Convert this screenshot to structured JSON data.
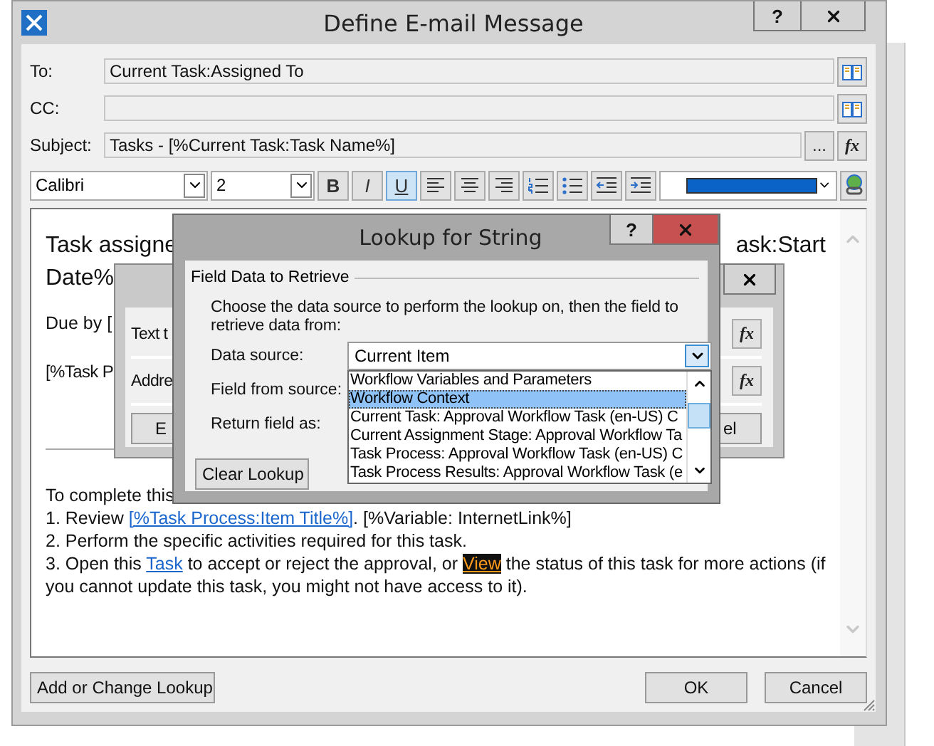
{
  "email_dialog": {
    "title": "Define E-mail Message",
    "help": "?",
    "fields": [
      {
        "label": "To:",
        "value": "Current Task:Assigned To",
        "kind": "address"
      },
      {
        "label": "CC:",
        "kind": "address"
      },
      {
        "label": "Subject:",
        "value": "Tasks - [%Current Task:Task Name%]",
        "kind": "formula",
        "buttons": [
          "...",
          "fx"
        ]
      }
    ],
    "toolbar": {
      "font": "Calibri",
      "size": "2",
      "styles": [
        {
          "label": "B",
          "selected": false
        },
        {
          "label": "I",
          "selected": false
        },
        {
          "label": "U",
          "selected": true
        }
      ]
    },
    "editor": {
      "heading_left": "Task assigne",
      "heading_right": "ask:Start",
      "heading_line2": "Date%",
      "due": "Due by [",
      "task_line": "[%Task P",
      "intro": "To complete this",
      "lines": [
        [
          {
            "kind": "text",
            "text": "1. Review "
          },
          {
            "kind": "link",
            "text": "[%Task Process:Item Title%]",
            "selected": false
          },
          {
            "kind": "text",
            "text": ". [%Variable: InternetLink%]"
          }
        ],
        [
          {
            "kind": "text",
            "text": "2. Perform the specific activities required for this task."
          }
        ],
        [
          {
            "kind": "text",
            "text": "3. Open this "
          },
          {
            "kind": "link",
            "text": "Task",
            "selected": false
          },
          {
            "kind": "text",
            "text": " to accept or reject the approval, or "
          },
          {
            "kind": "link",
            "text": "View",
            "selected": true
          },
          {
            "kind": "text",
            "text": " the status of this task for more actions (if you cannot update this task, you might not have access to it)."
          }
        ]
      ]
    },
    "buttons": [
      "Add or Change Lookup",
      "OK",
      "Cancel"
    ]
  },
  "hyperlink_dialog": {
    "rows": [
      {
        "label": "Text t",
        "button": "fx"
      },
      {
        "label": "Addre",
        "button": "fx"
      }
    ],
    "buttons": [
      "E",
      "el"
    ]
  },
  "lookup_dialog": {
    "title": "Lookup for String",
    "help": "?",
    "group": "Field Data to Retrieve",
    "description": "Choose the data source to perform the lookup on, then the field to retrieve data from:",
    "labels": [
      "Data source:",
      "Field from source:",
      "Return field as:"
    ],
    "data_source": "Current Item",
    "options": [
      {
        "label": "Workflow Variables and Parameters",
        "selected": false
      },
      {
        "label": "Workflow Context",
        "selected": true
      },
      {
        "label": "Current Task: Approval Workflow Task (en-US) C",
        "selected": false
      },
      {
        "label": "Current Assignment Stage: Approval Workflow Ta",
        "selected": false
      },
      {
        "label": "Task Process: Approval Workflow Task (en-US) C",
        "selected": false
      },
      {
        "label": "Task Process Results: Approval Workflow Task (e",
        "selected": false
      }
    ],
    "clear_button": "Clear Lookup"
  }
}
